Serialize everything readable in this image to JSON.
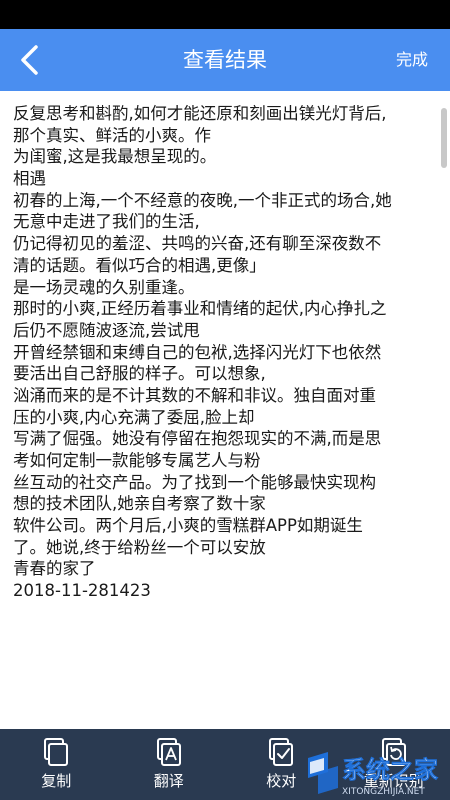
{
  "header": {
    "title": "查看结果",
    "done_label": "完成"
  },
  "content": {
    "lines": [
      "反复思考和斟酌,如何才能还原和刻画出镁光灯背后,",
      "那个真实、鲜活的小爽。作",
      "为闺蜜,这是我最想呈现的。",
      "相遇",
      "初春的上海,一个不经意的夜晚,一个非正式的场合,她",
      "无意中走进了我们的生活,",
      "仍记得初见的羞涩、共鸣的兴奋,还有聊至深夜数不",
      "清的话题。看似巧合的相遇,更像」",
      "是一场灵魂的久别重逢。",
      "那时的小爽,正经历着事业和情绪的起伏,内心挣扎之",
      "后仍不愿随波逐流,尝试甩",
      "开曾经禁锢和束缚自己的包袱,选择闪光灯下也依然",
      "要活出自己舒服的样子。可以想象,",
      "汹涌而来的是不计其数的不解和非议。独自面对重",
      "压的小爽,内心充满了委屈,脸上却",
      "写满了倔强。她没有停留在抱怨现实的不满,而是思",
      "考如何定制一款能够专属艺人与粉",
      "丝互动的社交产品。为了找到一个能够最快实现构",
      "想的技术团队,她亲自考察了数十家",
      "软件公司。两个月后,小爽的雪糕群APP如期诞生",
      "了。她说,终于给粉丝一个可以安放",
      "青春的家了",
      "2018-11-281423"
    ]
  },
  "bottom_bar": {
    "items": [
      {
        "label": "复制",
        "icon": "copy-icon"
      },
      {
        "label": "翻译",
        "icon": "translate-icon"
      },
      {
        "label": "校对",
        "icon": "proofread-icon"
      },
      {
        "label": "重新识别",
        "icon": "rescan-icon"
      }
    ]
  },
  "watermark": {
    "text": "系统之家",
    "subtext": "XITONGZHIJIA.NET"
  },
  "colors": {
    "header_bg": "#4a8ef0",
    "bottom_bar_bg": "#2a3a51",
    "status_bar_bg": "#000000"
  }
}
